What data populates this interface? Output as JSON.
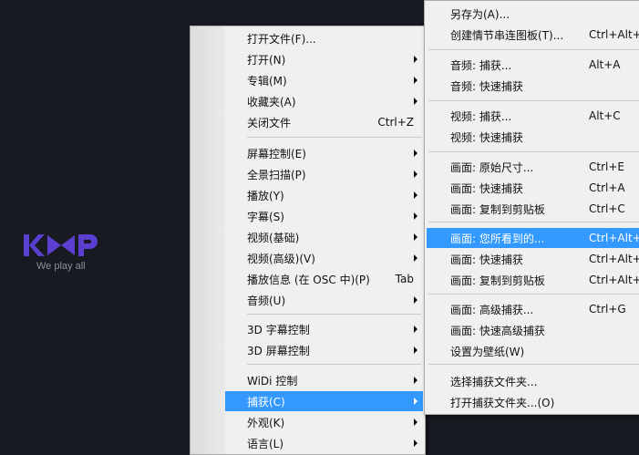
{
  "logo": {
    "text": "KMP",
    "tagline": "We play all"
  },
  "main_menu": [
    {
      "label": "打开文件(F)...",
      "shortcut": "",
      "submenu": false
    },
    {
      "label": "打开(N)",
      "shortcut": "",
      "submenu": true
    },
    {
      "label": "专辑(M)",
      "shortcut": "",
      "submenu": true
    },
    {
      "label": "收藏夹(A)",
      "shortcut": "",
      "submenu": true
    },
    {
      "label": "关闭文件",
      "shortcut": "Ctrl+Z",
      "submenu": false
    },
    {
      "label": "屏幕控制(E)",
      "shortcut": "",
      "submenu": true
    },
    {
      "label": "全景扫描(P)",
      "shortcut": "",
      "submenu": true
    },
    {
      "label": "播放(Y)",
      "shortcut": "",
      "submenu": true
    },
    {
      "label": "字幕(S)",
      "shortcut": "",
      "submenu": true
    },
    {
      "label": "视频(基础)",
      "shortcut": "",
      "submenu": true
    },
    {
      "label": "视频(高级)(V)",
      "shortcut": "",
      "submenu": true
    },
    {
      "label": "播放信息 (在 OSC 中)(P)",
      "shortcut": "Tab",
      "submenu": false
    },
    {
      "label": "音频(U)",
      "shortcut": "",
      "submenu": true
    },
    {
      "label": "3D 字幕控制",
      "shortcut": "",
      "submenu": true
    },
    {
      "label": "3D 屏幕控制",
      "shortcut": "",
      "submenu": true
    },
    {
      "label": "WiDi 控制",
      "shortcut": "",
      "submenu": true
    },
    {
      "label": "捕获(C)",
      "shortcut": "",
      "submenu": true,
      "active": true
    },
    {
      "label": "外观(K)",
      "shortcut": "",
      "submenu": true
    },
    {
      "label": "语言(L)",
      "shortcut": "",
      "submenu": true
    }
  ],
  "capture_submenu": [
    {
      "label": "另存为(A)...",
      "shortcut": ""
    },
    {
      "label": "创建情节串连图板(T)...",
      "shortcut": "Ctrl+Alt+S"
    },
    {
      "label": "音频: 捕获...",
      "shortcut": "Alt+A"
    },
    {
      "label": "音频: 快速捕获",
      "shortcut": ""
    },
    {
      "label": "视频: 捕获...",
      "shortcut": "Alt+C"
    },
    {
      "label": "视频: 快速捕获",
      "shortcut": ""
    },
    {
      "label": "画面: 原始尺寸...",
      "shortcut": "Ctrl+E"
    },
    {
      "label": "画面: 快速捕获",
      "shortcut": "Ctrl+A"
    },
    {
      "label": "画面: 复制到剪贴板",
      "shortcut": "Ctrl+C"
    },
    {
      "label": "画面: 您所看到的...",
      "shortcut": "Ctrl+Alt+E",
      "active": true
    },
    {
      "label": "画面: 快速捕获",
      "shortcut": "Ctrl+Alt+A"
    },
    {
      "label": "画面: 复制到剪贴板",
      "shortcut": "Ctrl+Alt+C"
    },
    {
      "label": "画面: 高级捕获...",
      "shortcut": "Ctrl+G"
    },
    {
      "label": "画面: 快速高级捕获",
      "shortcut": ""
    },
    {
      "label": "设置为壁纸(W)",
      "shortcut": ""
    },
    {
      "label": "选择捕获文件夹...",
      "shortcut": ""
    },
    {
      "label": "打开捕获文件夹...(O)",
      "shortcut": ""
    }
  ],
  "colors": {
    "background": "#171a21",
    "menu_bg": "#f0f0f0",
    "highlight": "#3399ff",
    "logo_purple": "#5b3fd0"
  }
}
